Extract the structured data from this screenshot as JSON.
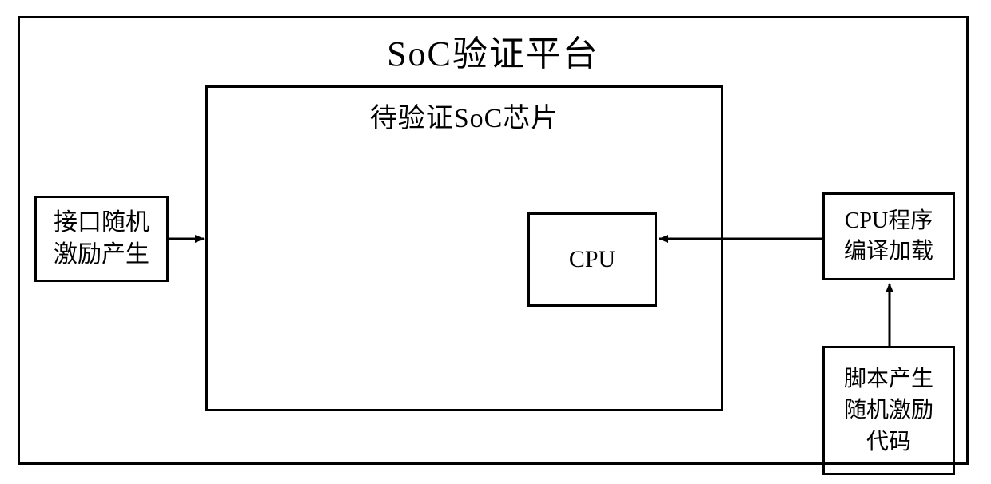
{
  "title": "SoC验证平台",
  "soc": {
    "title": "待验证SoC芯片",
    "cpu_label": "CPU"
  },
  "left_box": {
    "line1": "接口随机",
    "line2": "激励产生"
  },
  "right_box": {
    "line1": "CPU程序",
    "line2": "编译加载"
  },
  "bottom_right_box": {
    "line1": "脚本产生",
    "line2": "随机激励",
    "line3": "代码"
  }
}
